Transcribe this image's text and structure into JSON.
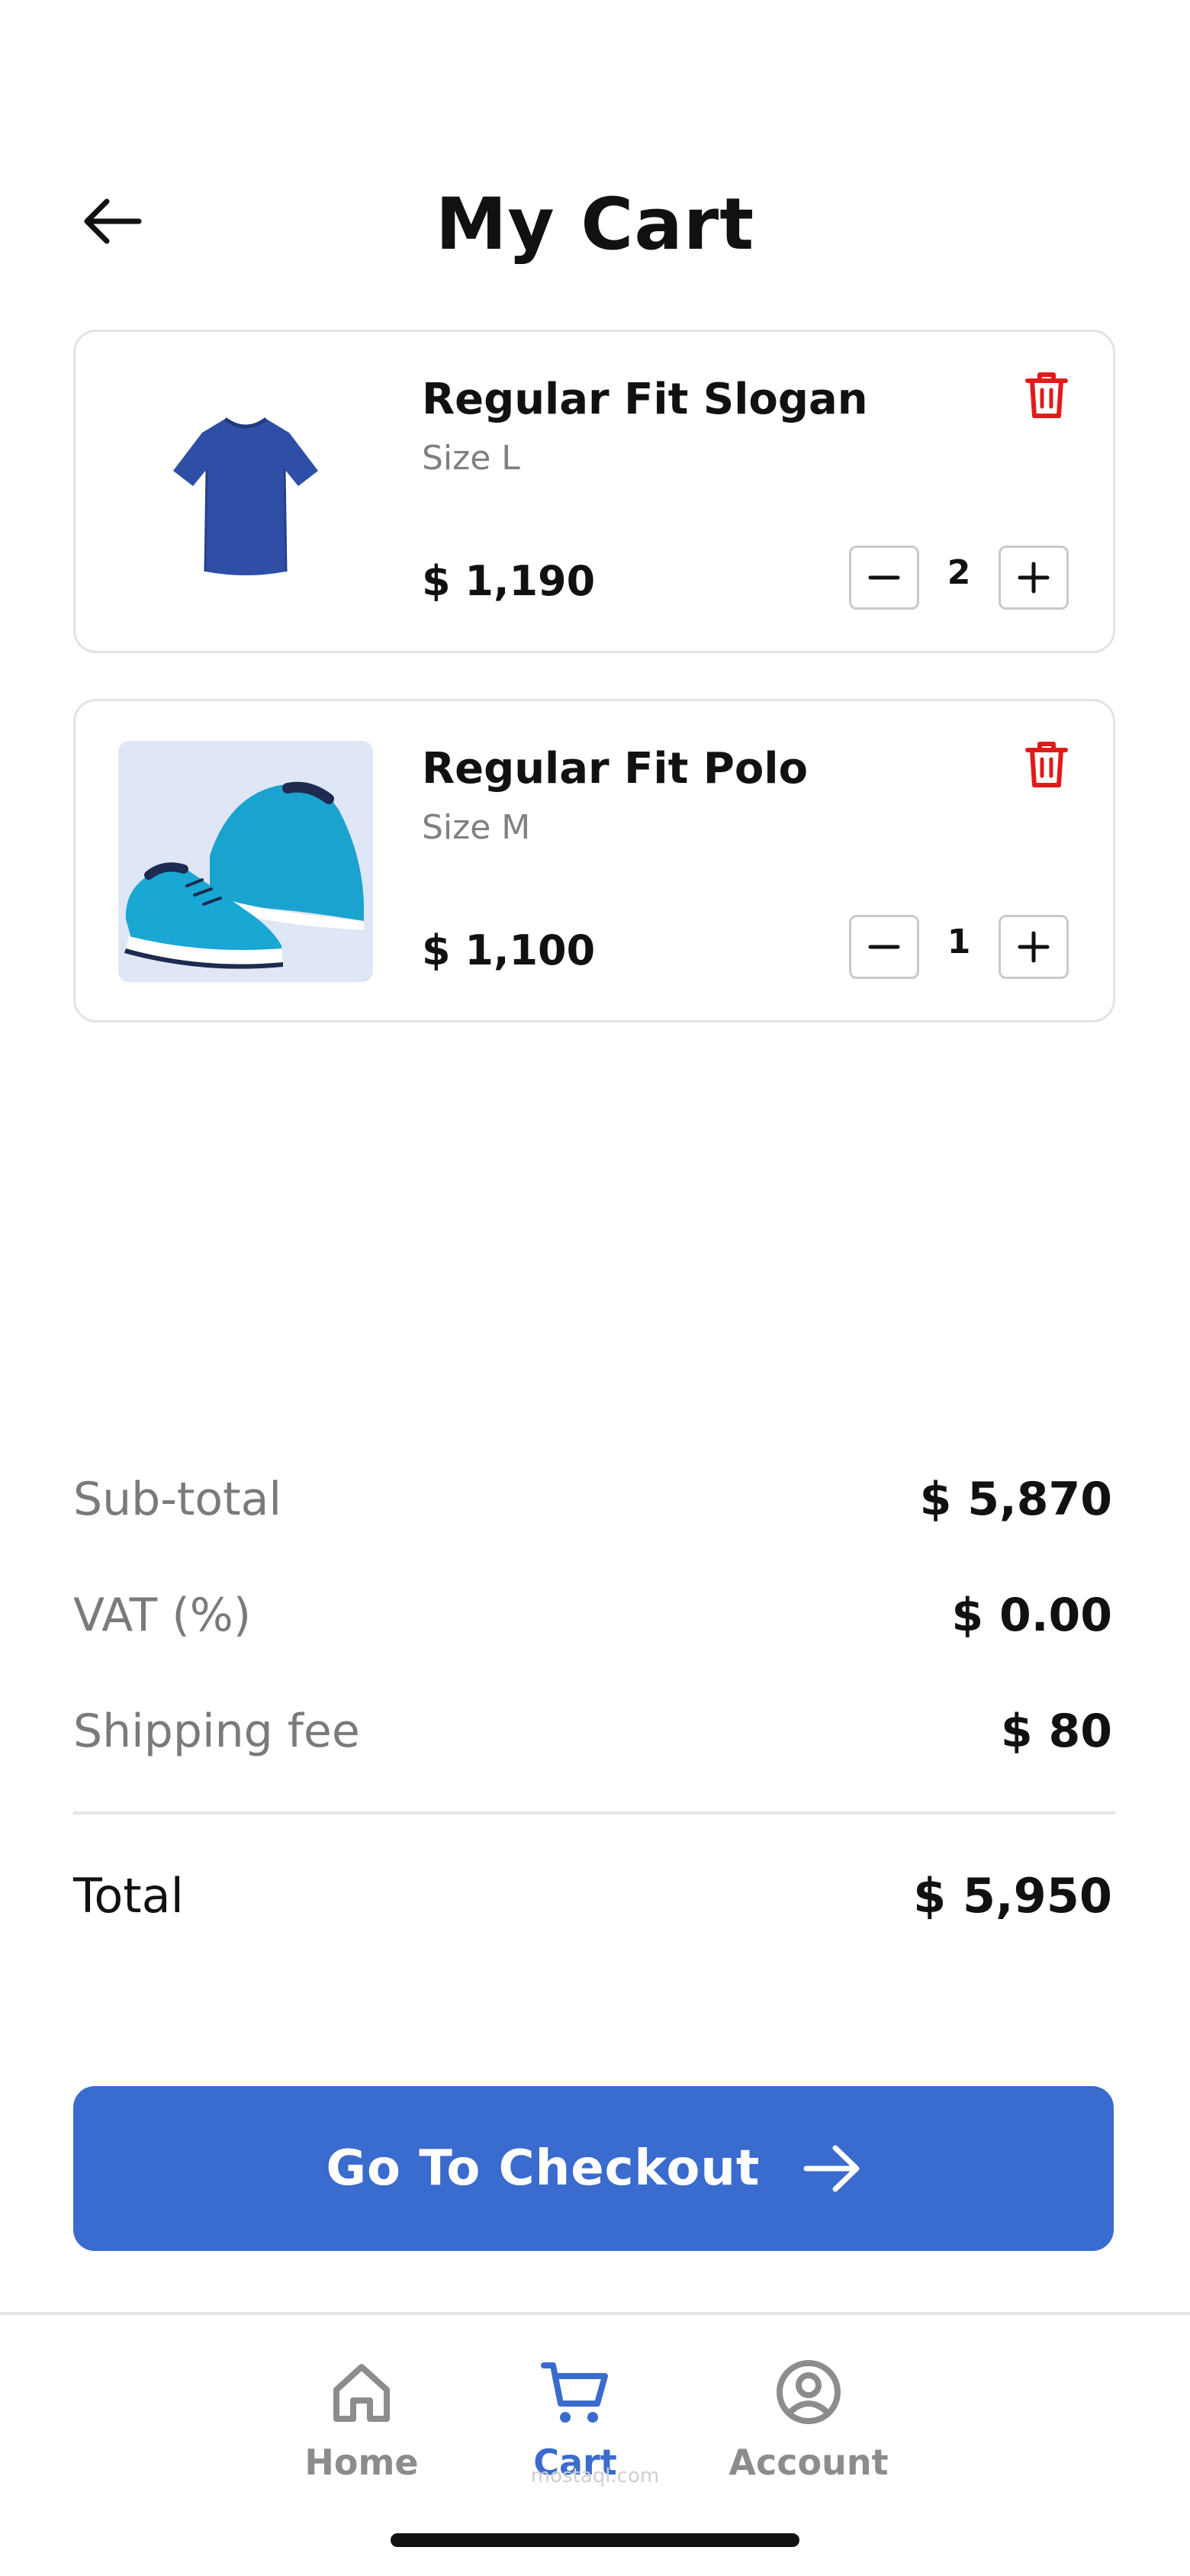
{
  "header": {
    "title": "My Cart"
  },
  "cart": {
    "items": [
      {
        "name": "Regular Fit Slogan",
        "size": "Size L",
        "price": "$ 1,190",
        "quantity": "2",
        "image": "blue-tshirt"
      },
      {
        "name": "Regular Fit Polo",
        "size": "Size M",
        "price": "$ 1,100",
        "quantity": "1",
        "image": "blue-sneakers"
      }
    ]
  },
  "summary": {
    "subtotal_label": "Sub-total",
    "subtotal_value": "$ 5,870",
    "vat_label": "VAT (%)",
    "vat_value": "$ 0.00",
    "shipping_label": "Shipping fee",
    "shipping_value": "$ 80",
    "total_label": "Total",
    "total_value": "$ 5,950"
  },
  "checkout": {
    "label": "Go To Checkout"
  },
  "nav": {
    "items": [
      {
        "label": "Home",
        "icon": "home-icon",
        "active": false
      },
      {
        "label": "Cart",
        "icon": "cart-icon",
        "active": true
      },
      {
        "label": "Account",
        "icon": "account-icon",
        "active": false
      }
    ]
  },
  "watermark": "mostaql.com",
  "colors": {
    "accent": "#3a6bce",
    "danger": "#e01b1b",
    "muted": "#7a7a7a"
  }
}
